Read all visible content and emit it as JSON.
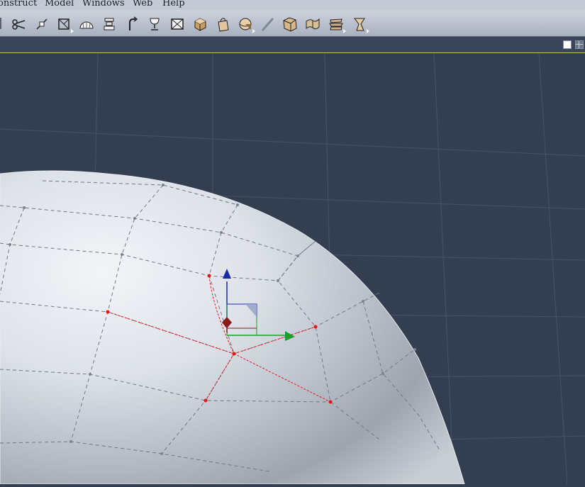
{
  "menu": {
    "items": [
      "onstruct",
      "Model",
      "Windows",
      "Web",
      "Help"
    ]
  },
  "toolbar": {
    "tools": [
      {
        "name": "cut-icon",
        "has_submenu": false
      },
      {
        "name": "vertex-tool-icon",
        "has_submenu": false
      },
      {
        "name": "bevel-tool-icon",
        "has_submenu": true
      },
      {
        "name": "dome-icon",
        "has_submenu": false
      },
      {
        "name": "extrude-icon",
        "has_submenu": false
      },
      {
        "name": "bend-arrow-icon",
        "has_submenu": false
      },
      {
        "name": "lathe-goblet-icon",
        "has_submenu": false
      },
      {
        "name": "face-box-icon",
        "has_submenu": false
      },
      {
        "name": "cube-icon",
        "has_submenu": false
      },
      {
        "name": "bag-icon",
        "has_submenu": false
      },
      {
        "name": "sphere-icon",
        "has_submenu": true
      },
      {
        "name": "knife-icon",
        "has_submenu": false
      },
      {
        "name": "deform-box-icon",
        "has_submenu": false
      },
      {
        "name": "deform-flag-icon",
        "has_submenu": false
      },
      {
        "name": "deform-stack-icon",
        "has_submenu": true
      },
      {
        "name": "deform-twist-icon",
        "has_submenu": true
      }
    ]
  },
  "view": {
    "layout_options": [
      "single-view-icon",
      "quad-view-icon"
    ],
    "active_layout": "single-view-icon"
  },
  "colors": {
    "background": "#343e51",
    "grid": "#47526a",
    "selection": "#e8141a",
    "axis_y": "#1a2aa8",
    "axis_x": "#17a32b",
    "axis_z": "#8b1a1a"
  }
}
